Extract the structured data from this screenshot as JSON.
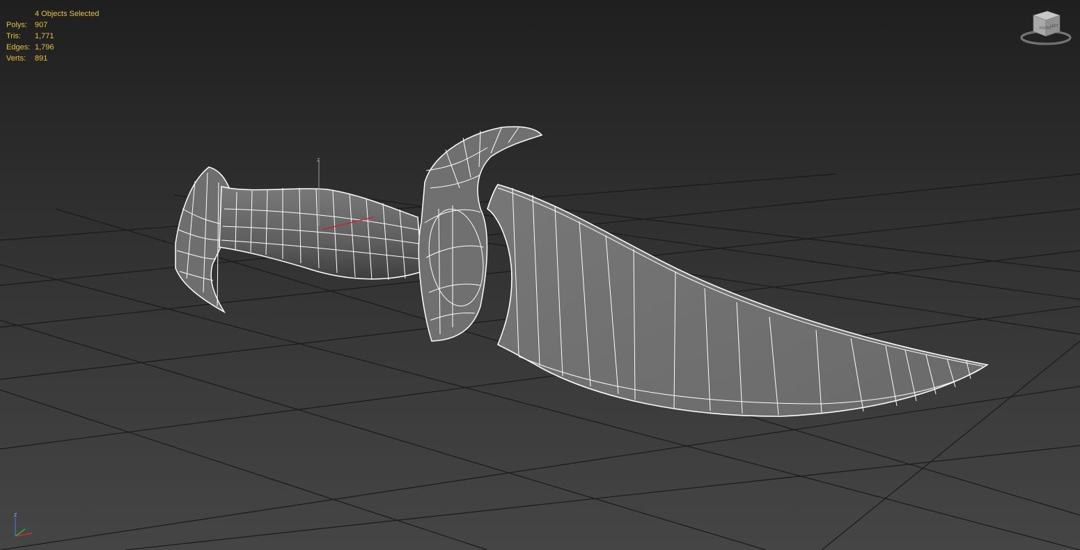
{
  "viewport": {
    "selection_label": "4 Objects Selected",
    "stats": [
      {
        "label": "Polys:",
        "value": "907"
      },
      {
        "label": "Tris:",
        "value": "1,771"
      },
      {
        "label": "Edges:",
        "value": "1,796"
      },
      {
        "label": "Verts:",
        "value": "891"
      }
    ],
    "stats_color": "#e3c33b",
    "gizmo_axis_label": "z",
    "viewcube": {
      "face_label_left": "FRONT",
      "face_label_right": "LEFT"
    },
    "tripod_axis_label": "z",
    "mesh_color": "#6a6a6a",
    "wire_color": "#ffffff",
    "grid_color": "#1c1c1c"
  }
}
